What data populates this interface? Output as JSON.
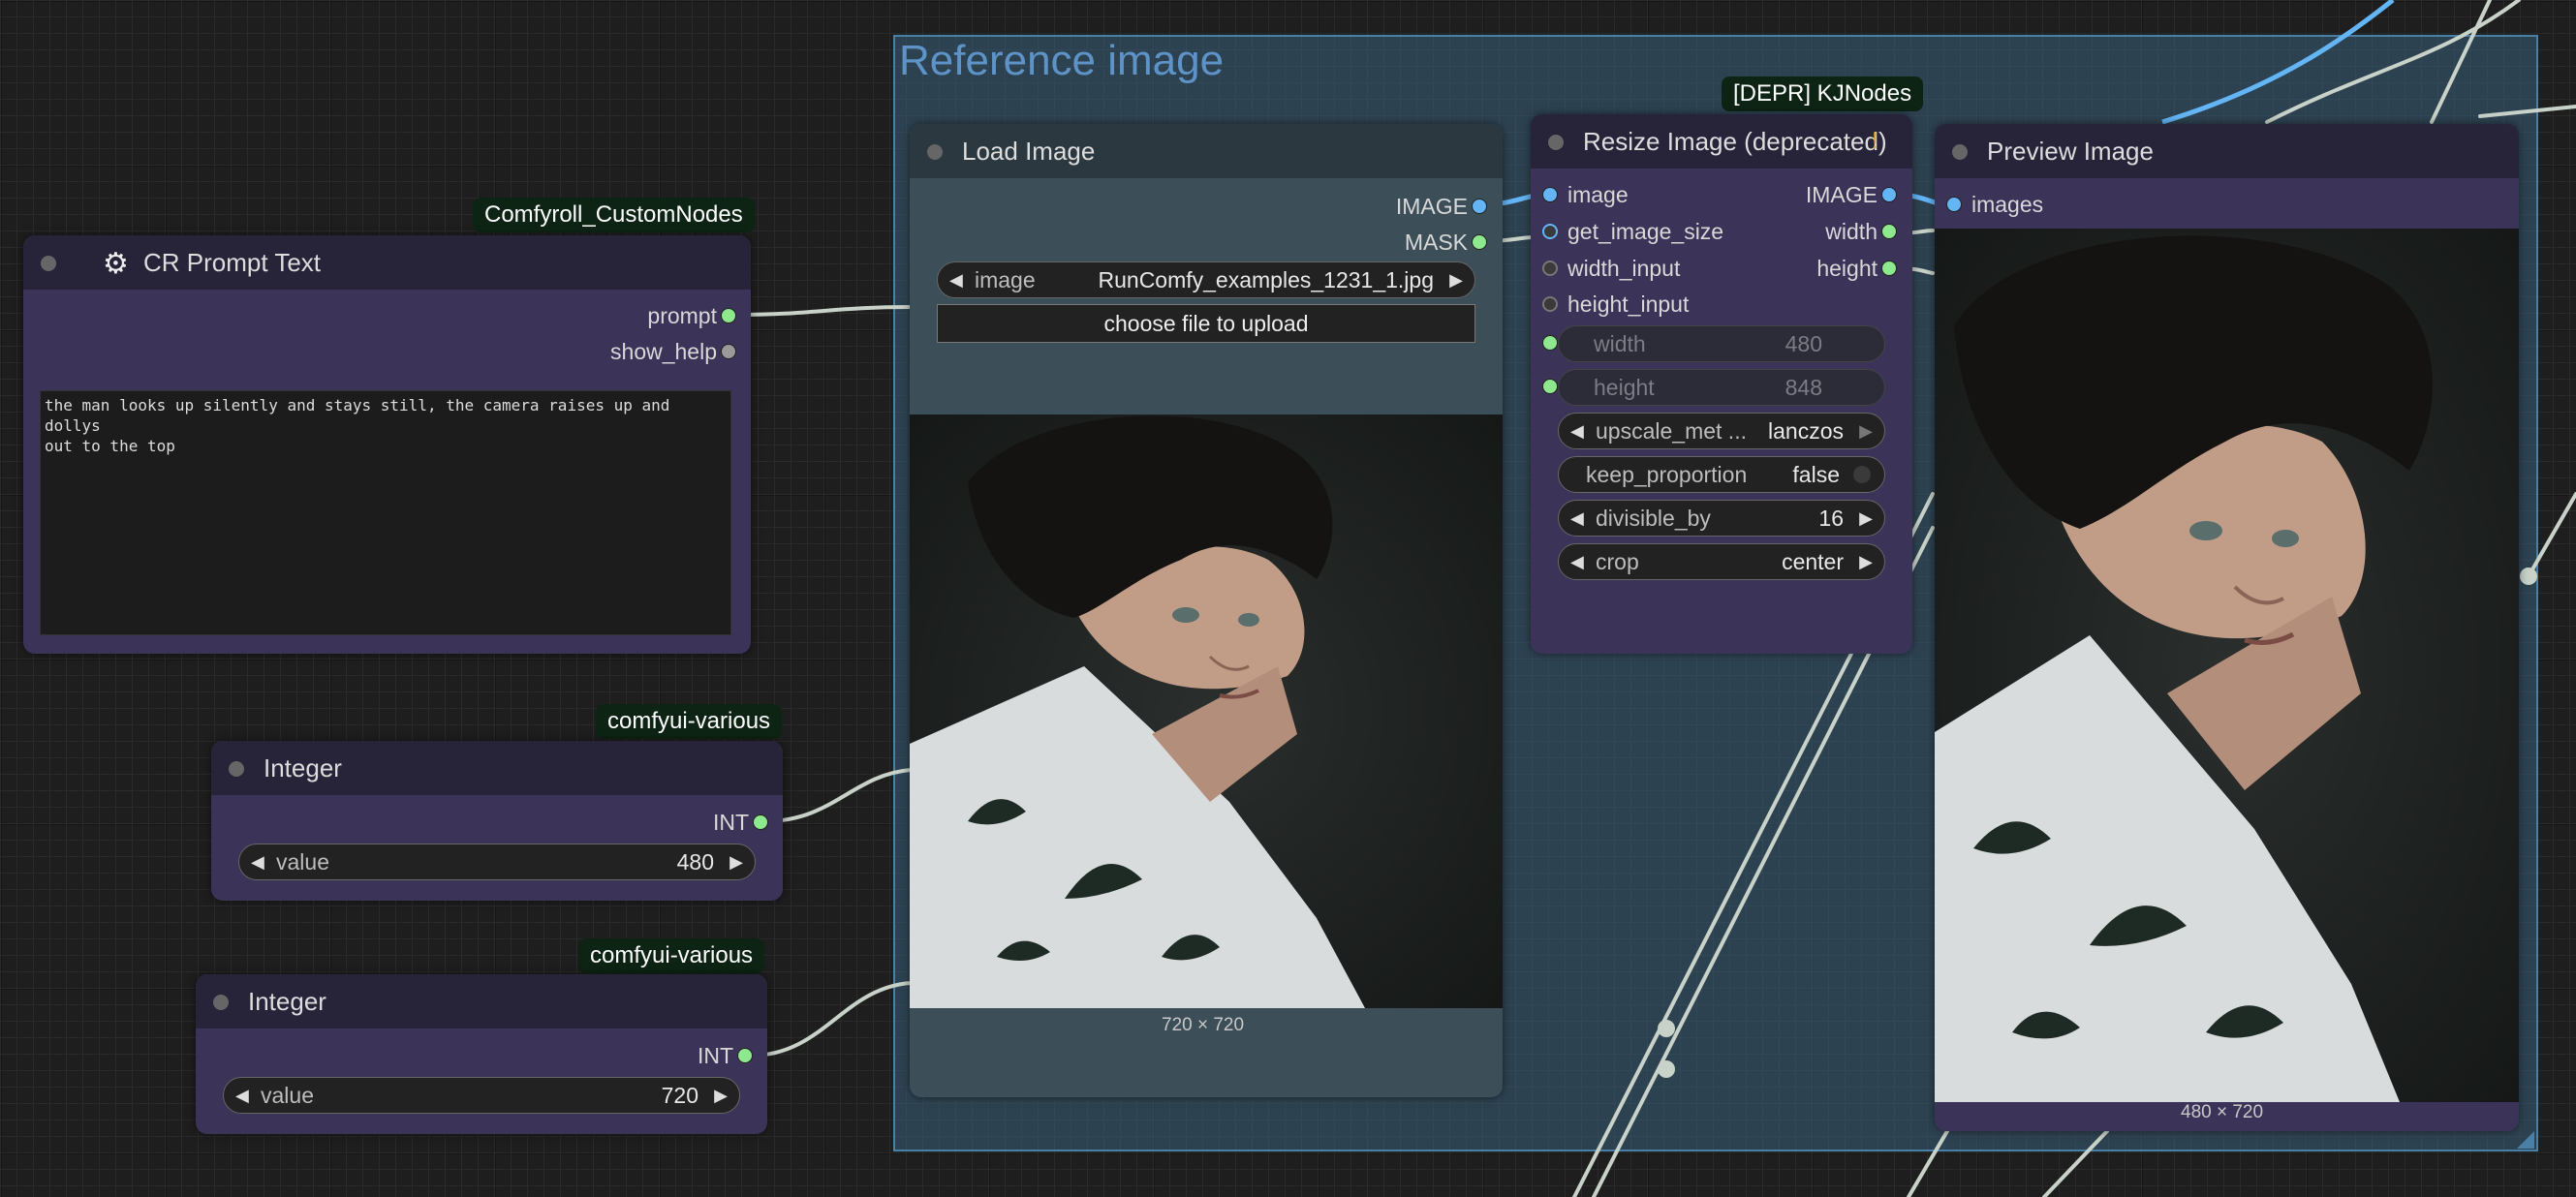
{
  "group": {
    "title": "Reference image"
  },
  "badges": {
    "comfyroll": "Comfyroll_CustomNodes",
    "various1": "comfyui-various",
    "various2": "comfyui-various",
    "kjnodes": "[DEPR] KJNodes"
  },
  "cr_prompt": {
    "title": "CR Prompt Text",
    "outputs": [
      "prompt",
      "show_help"
    ],
    "text": "the man looks up silently and stays still, the camera raises up and dollys\nout to the top"
  },
  "int1": {
    "title": "Integer",
    "output": "INT",
    "widget_label": "value",
    "widget_value": "480"
  },
  "int2": {
    "title": "Integer",
    "output": "INT",
    "widget_label": "value",
    "widget_value": "720"
  },
  "load_image": {
    "title": "Load Image",
    "outputs": [
      "IMAGE",
      "MASK"
    ],
    "image_label": "image",
    "image_value": "RunComfy_examples_1231_1.jpg",
    "upload_label": "choose file to upload",
    "dims": "720 × 720"
  },
  "resize": {
    "title": "Resize Image (deprecated)",
    "warn": "!",
    "inputs": [
      "image",
      "get_image_size",
      "width_input",
      "height_input"
    ],
    "outputs": [
      "IMAGE",
      "width",
      "height"
    ],
    "width_label": "width",
    "width_value": "480",
    "height_label": "height",
    "height_value": "848",
    "upscale_label": "upscale_met ...",
    "upscale_value": "lanczos",
    "keep_label": "keep_proportion",
    "keep_value": "false",
    "div_label": "divisible_by",
    "div_value": "16",
    "crop_label": "crop",
    "crop_value": "center"
  },
  "preview": {
    "title": "Preview Image",
    "input": "images",
    "dims": "480 × 720"
  },
  "colors": {
    "node_body": "#3b3358",
    "node_title": "#27243a",
    "group": "#3a607c",
    "wire": "#c8d2c8",
    "image_wire": "#64b5f6",
    "badge": "#0d2414"
  }
}
